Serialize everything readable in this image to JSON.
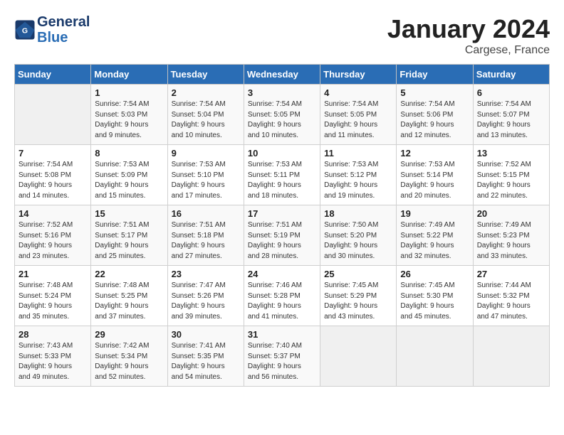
{
  "header": {
    "logo_line1": "General",
    "logo_line2": "Blue",
    "month": "January 2024",
    "location": "Cargese, France"
  },
  "days_of_week": [
    "Sunday",
    "Monday",
    "Tuesday",
    "Wednesday",
    "Thursday",
    "Friday",
    "Saturday"
  ],
  "weeks": [
    [
      {
        "day": "",
        "sunrise": "",
        "sunset": "",
        "daylight": ""
      },
      {
        "day": "1",
        "sunrise": "7:54 AM",
        "sunset": "5:03 PM",
        "daylight": "9 hours and 9 minutes."
      },
      {
        "day": "2",
        "sunrise": "7:54 AM",
        "sunset": "5:04 PM",
        "daylight": "9 hours and 10 minutes."
      },
      {
        "day": "3",
        "sunrise": "7:54 AM",
        "sunset": "5:05 PM",
        "daylight": "9 hours and 10 minutes."
      },
      {
        "day": "4",
        "sunrise": "7:54 AM",
        "sunset": "5:05 PM",
        "daylight": "9 hours and 11 minutes."
      },
      {
        "day": "5",
        "sunrise": "7:54 AM",
        "sunset": "5:06 PM",
        "daylight": "9 hours and 12 minutes."
      },
      {
        "day": "6",
        "sunrise": "7:54 AM",
        "sunset": "5:07 PM",
        "daylight": "9 hours and 13 minutes."
      }
    ],
    [
      {
        "day": "7",
        "sunrise": "7:54 AM",
        "sunset": "5:08 PM",
        "daylight": "9 hours and 14 minutes."
      },
      {
        "day": "8",
        "sunrise": "7:53 AM",
        "sunset": "5:09 PM",
        "daylight": "9 hours and 15 minutes."
      },
      {
        "day": "9",
        "sunrise": "7:53 AM",
        "sunset": "5:10 PM",
        "daylight": "9 hours and 17 minutes."
      },
      {
        "day": "10",
        "sunrise": "7:53 AM",
        "sunset": "5:11 PM",
        "daylight": "9 hours and 18 minutes."
      },
      {
        "day": "11",
        "sunrise": "7:53 AM",
        "sunset": "5:12 PM",
        "daylight": "9 hours and 19 minutes."
      },
      {
        "day": "12",
        "sunrise": "7:53 AM",
        "sunset": "5:14 PM",
        "daylight": "9 hours and 20 minutes."
      },
      {
        "day": "13",
        "sunrise": "7:52 AM",
        "sunset": "5:15 PM",
        "daylight": "9 hours and 22 minutes."
      }
    ],
    [
      {
        "day": "14",
        "sunrise": "7:52 AM",
        "sunset": "5:16 PM",
        "daylight": "9 hours and 23 minutes."
      },
      {
        "day": "15",
        "sunrise": "7:51 AM",
        "sunset": "5:17 PM",
        "daylight": "9 hours and 25 minutes."
      },
      {
        "day": "16",
        "sunrise": "7:51 AM",
        "sunset": "5:18 PM",
        "daylight": "9 hours and 27 minutes."
      },
      {
        "day": "17",
        "sunrise": "7:51 AM",
        "sunset": "5:19 PM",
        "daylight": "9 hours and 28 minutes."
      },
      {
        "day": "18",
        "sunrise": "7:50 AM",
        "sunset": "5:20 PM",
        "daylight": "9 hours and 30 minutes."
      },
      {
        "day": "19",
        "sunrise": "7:49 AM",
        "sunset": "5:22 PM",
        "daylight": "9 hours and 32 minutes."
      },
      {
        "day": "20",
        "sunrise": "7:49 AM",
        "sunset": "5:23 PM",
        "daylight": "9 hours and 33 minutes."
      }
    ],
    [
      {
        "day": "21",
        "sunrise": "7:48 AM",
        "sunset": "5:24 PM",
        "daylight": "9 hours and 35 minutes."
      },
      {
        "day": "22",
        "sunrise": "7:48 AM",
        "sunset": "5:25 PM",
        "daylight": "9 hours and 37 minutes."
      },
      {
        "day": "23",
        "sunrise": "7:47 AM",
        "sunset": "5:26 PM",
        "daylight": "9 hours and 39 minutes."
      },
      {
        "day": "24",
        "sunrise": "7:46 AM",
        "sunset": "5:28 PM",
        "daylight": "9 hours and 41 minutes."
      },
      {
        "day": "25",
        "sunrise": "7:45 AM",
        "sunset": "5:29 PM",
        "daylight": "9 hours and 43 minutes."
      },
      {
        "day": "26",
        "sunrise": "7:45 AM",
        "sunset": "5:30 PM",
        "daylight": "9 hours and 45 minutes."
      },
      {
        "day": "27",
        "sunrise": "7:44 AM",
        "sunset": "5:32 PM",
        "daylight": "9 hours and 47 minutes."
      }
    ],
    [
      {
        "day": "28",
        "sunrise": "7:43 AM",
        "sunset": "5:33 PM",
        "daylight": "9 hours and 49 minutes."
      },
      {
        "day": "29",
        "sunrise": "7:42 AM",
        "sunset": "5:34 PM",
        "daylight": "9 hours and 52 minutes."
      },
      {
        "day": "30",
        "sunrise": "7:41 AM",
        "sunset": "5:35 PM",
        "daylight": "9 hours and 54 minutes."
      },
      {
        "day": "31",
        "sunrise": "7:40 AM",
        "sunset": "5:37 PM",
        "daylight": "9 hours and 56 minutes."
      },
      {
        "day": "",
        "sunrise": "",
        "sunset": "",
        "daylight": ""
      },
      {
        "day": "",
        "sunrise": "",
        "sunset": "",
        "daylight": ""
      },
      {
        "day": "",
        "sunrise": "",
        "sunset": "",
        "daylight": ""
      }
    ]
  ]
}
